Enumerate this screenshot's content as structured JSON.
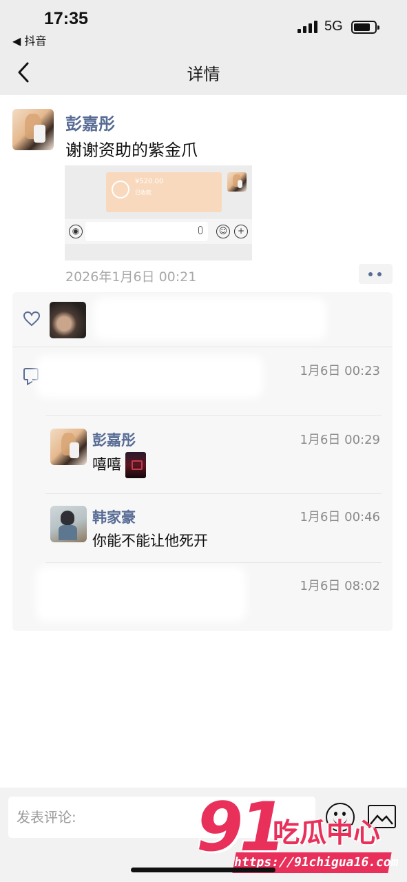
{
  "status_bar": {
    "time": "17:35",
    "back_app": "◀ 抖音",
    "network": "5G"
  },
  "nav": {
    "title": "详情",
    "back_icon": "chevron-left-icon"
  },
  "post": {
    "author": "彭嘉彤",
    "text": "谢谢资助的紫金爪",
    "date": "2026年1月6日 00:21",
    "screenshot": {
      "amount": "¥520.00",
      "sub": "已收款"
    }
  },
  "likes": {
    "icon": "heart-icon"
  },
  "comments": [
    {
      "name": "",
      "text": "",
      "time": "1月6日 00:23",
      "obscured": true
    },
    {
      "name": "彭嘉彤",
      "text": "嘻嘻",
      "time": "1月6日 00:29",
      "has_sticker": true
    },
    {
      "name": "韩家豪",
      "text": "你能不能让他死开",
      "time": "1月6日 00:46"
    },
    {
      "name": "",
      "text": "",
      "time": "1月6日 08:02",
      "obscured": true
    }
  ],
  "composer": {
    "placeholder": "发表评论:",
    "emoji_icon": "smiley-icon",
    "image_icon": "image-icon"
  },
  "watermark": {
    "number": "91",
    "chinese": "吃瓜中心",
    "url": "https://91chigua16.com",
    "color": "#e8305a"
  },
  "colors": {
    "name_link": "#576b95",
    "panel_bg": "#f7f7f7",
    "header_bg": "#ededed"
  }
}
